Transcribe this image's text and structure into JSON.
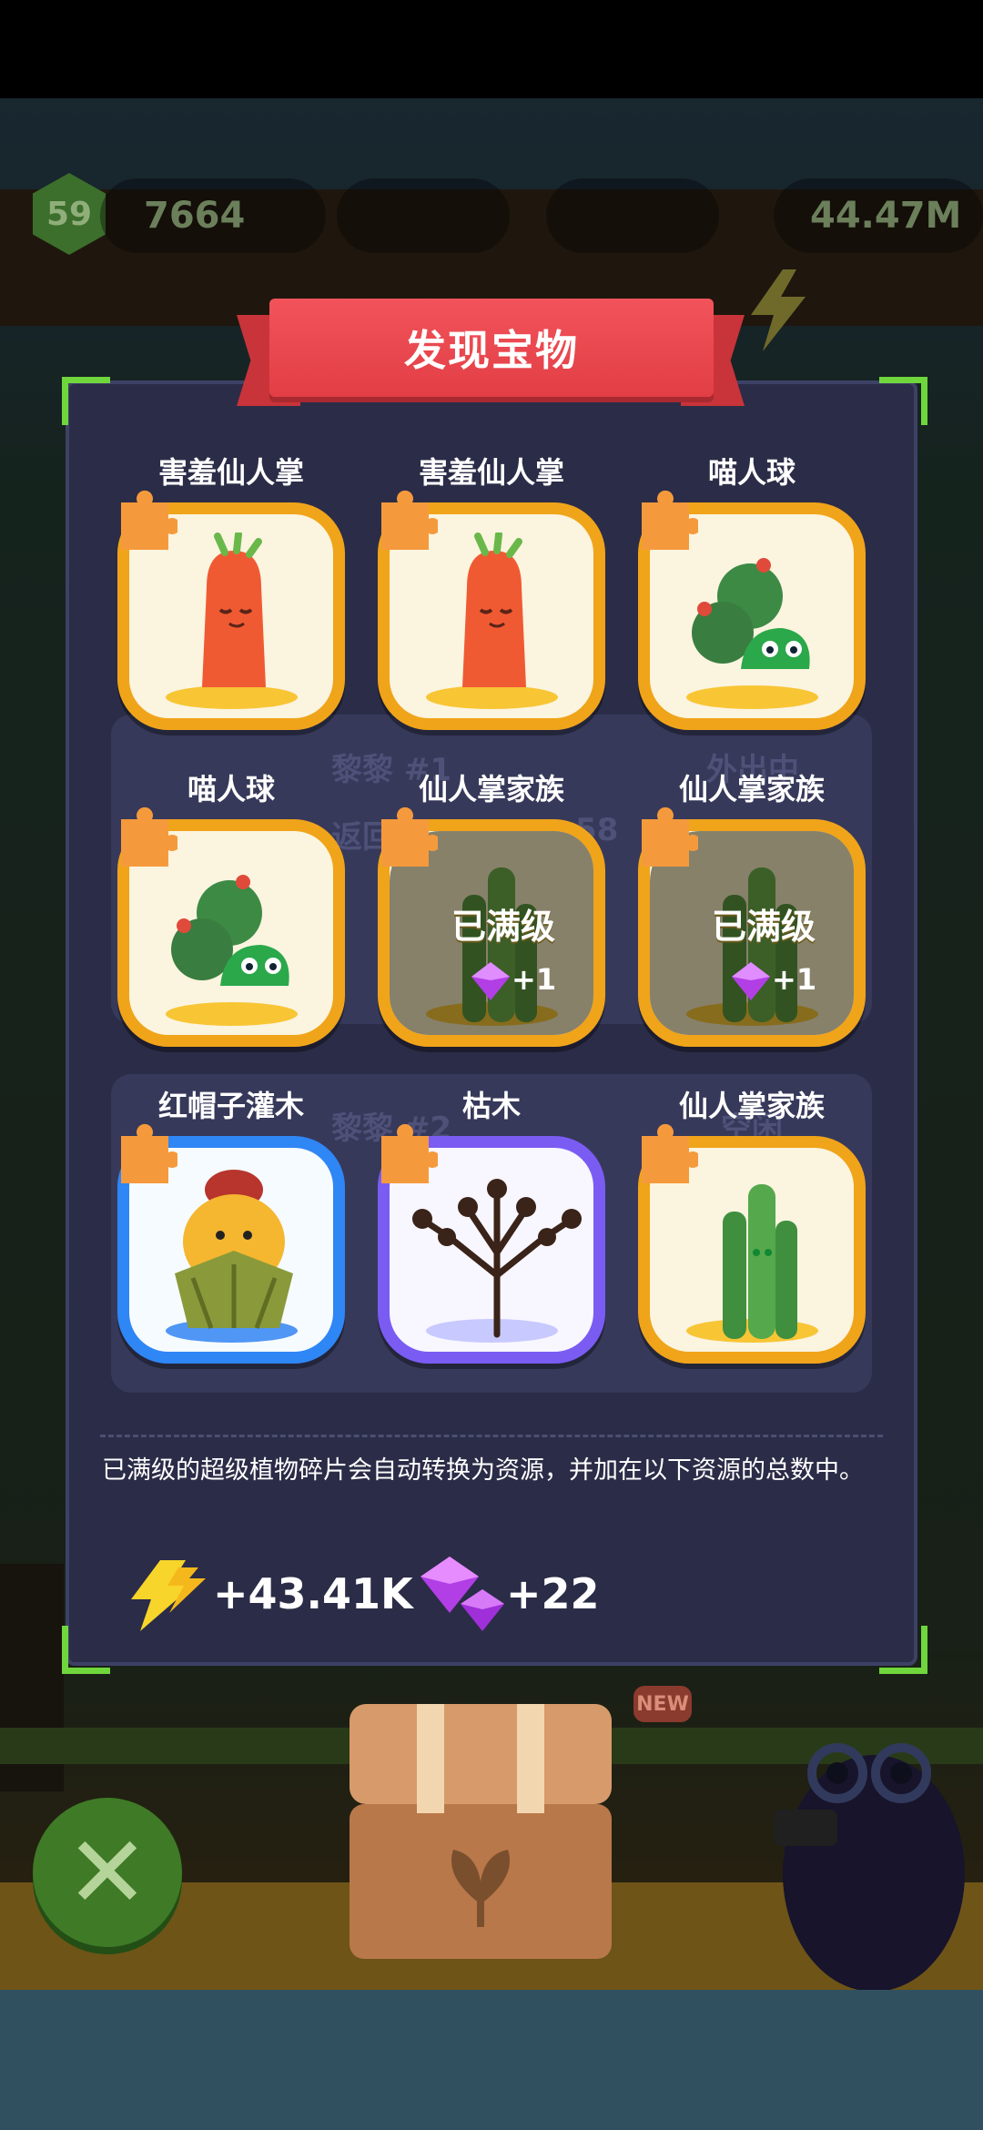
{
  "hud": {
    "level": "59",
    "coins": "7664",
    "energy": "44.47M"
  },
  "title": "发现宝物",
  "background_labels": {
    "row1_name": "黎黎 #1",
    "row1_status": "外出中",
    "row1_return": "返回",
    "row1_timer": "58",
    "row2_name": "黎黎 #2",
    "row2_status": "空闲"
  },
  "cards": [
    {
      "name": "害羞仙人掌",
      "frame": "gold",
      "plant": "shy-cactus",
      "maxed": false
    },
    {
      "name": "害羞仙人掌",
      "frame": "gold",
      "plant": "shy-cactus",
      "maxed": false
    },
    {
      "name": "喵人球",
      "frame": "gold",
      "plant": "cat-ball",
      "maxed": false
    },
    {
      "name": "喵人球",
      "frame": "gold",
      "plant": "cat-ball",
      "maxed": false
    },
    {
      "name": "仙人掌家族",
      "frame": "gold",
      "plant": "cactus-family",
      "maxed": true,
      "maxed_label": "已满级",
      "reward": "+1"
    },
    {
      "name": "仙人掌家族",
      "frame": "gold",
      "plant": "cactus-family",
      "maxed": true,
      "maxed_label": "已满级",
      "reward": "+1"
    },
    {
      "name": "红帽子灌木",
      "frame": "blue",
      "plant": "red-hat-shrub",
      "maxed": false
    },
    {
      "name": "枯木",
      "frame": "purple",
      "plant": "dead-tree",
      "maxed": false
    },
    {
      "name": "仙人掌家族",
      "frame": "gold",
      "plant": "cactus-family",
      "maxed": false
    }
  ],
  "note": "已满级的超级植物碎片会自动转换为资源，并加在以下资源的总数中。",
  "resources": {
    "energy": "+43.41K",
    "gems": "+22"
  },
  "new_badge": "NEW",
  "close_symbol": "✕",
  "colors": {
    "ribbon": "#e8434b",
    "panel": "#2b2c47",
    "gold_frame": "#f0a41a",
    "blue_frame": "#2f86f5",
    "purple_frame": "#7a5cf3",
    "corner": "#6fd63c"
  }
}
